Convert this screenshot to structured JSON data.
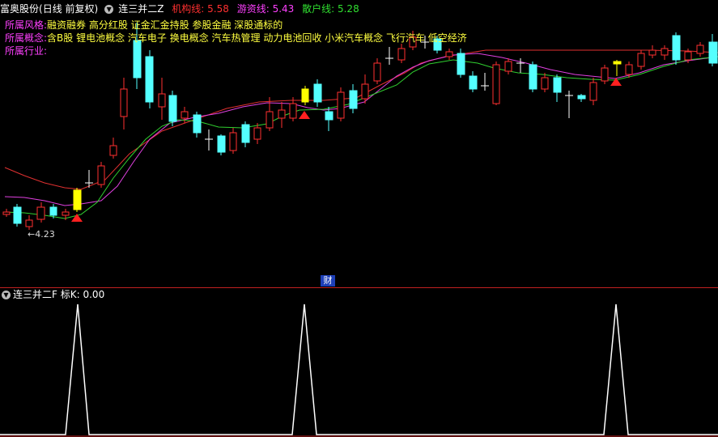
{
  "header": {
    "stock_name": "富奥股份",
    "period": "(日线 前复权)",
    "indicator_name": "连三并二Z",
    "lines": [
      {
        "label": "机构线",
        "value": "5.58",
        "color": "#ff3030"
      },
      {
        "label": "游资线",
        "value": "5.43",
        "color": "#ff40ff"
      },
      {
        "label": "散户线",
        "value": "5.28",
        "color": "#30e030"
      }
    ]
  },
  "info": {
    "style_label": "所属风格:",
    "style_value": "融资融券 高分红股 证金汇金持股 参股金融 深股通标的",
    "concept_label": "所属概念:",
    "concept_value": "含B股 锂电池概念 汽车电子 换电概念 汽车热管理 动力电池回收 小米汽车概念 飞行汽车 低空经济",
    "industry_label": "所属行业:",
    "industry_value": ""
  },
  "chart": {
    "low_marker": "←4.23",
    "finance_badge": "财",
    "colors": {
      "up": "#ff3030",
      "down": "#54ffff",
      "signal": "#ffff00",
      "arrow": "#ff2020"
    }
  },
  "sub_panel": {
    "title": "连三并二F",
    "value_label": "标K:",
    "value": "0.00"
  }
}
